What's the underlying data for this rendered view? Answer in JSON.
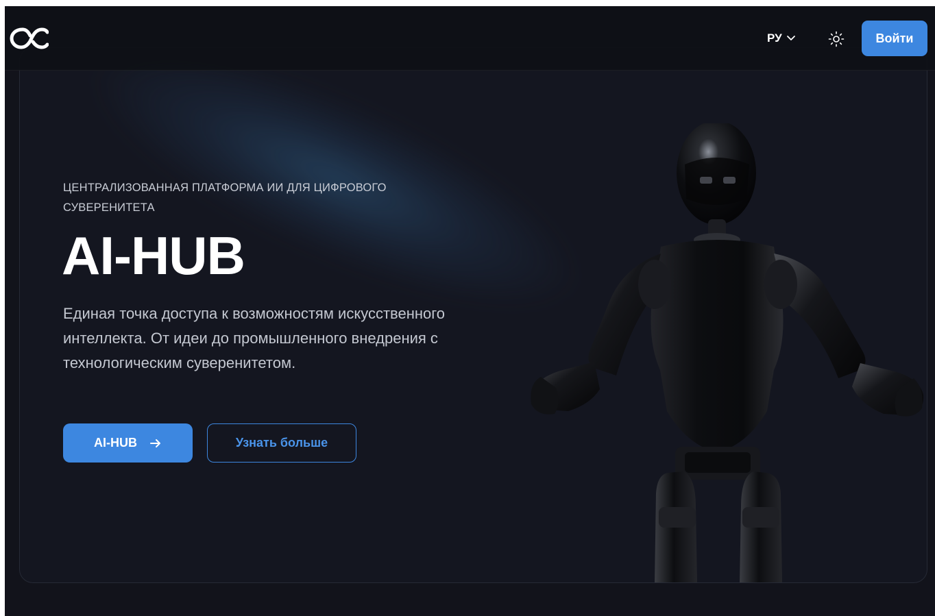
{
  "header": {
    "logo_icon": "ac-logo-icon",
    "language": "РУ",
    "language_icon": "chevron-down-icon",
    "theme_icon": "sun-icon",
    "login_label": "Войти"
  },
  "hero": {
    "eyebrow": "ЦЕНТРАЛИЗОВАННАЯ ПЛАТФОРМА ИИ ДЛЯ ЦИФРОВОГО СУВЕРЕНИТЕТА",
    "title": "AI-HUB",
    "description": "Единая точка доступа к возможностям искусственного интеллекта. От идеи до промышленного внедрения с технологическим суверенитетом.",
    "primary_button": "AI-HUB",
    "primary_button_icon": "arrow-right-icon",
    "secondary_button": "Узнать больше",
    "image": "humanoid-robot-image"
  },
  "colors": {
    "background": "#12131b",
    "card": "#141620",
    "accent": "#3d87e0",
    "text": "#ffffff",
    "muted_text": "#c4c8d1"
  }
}
